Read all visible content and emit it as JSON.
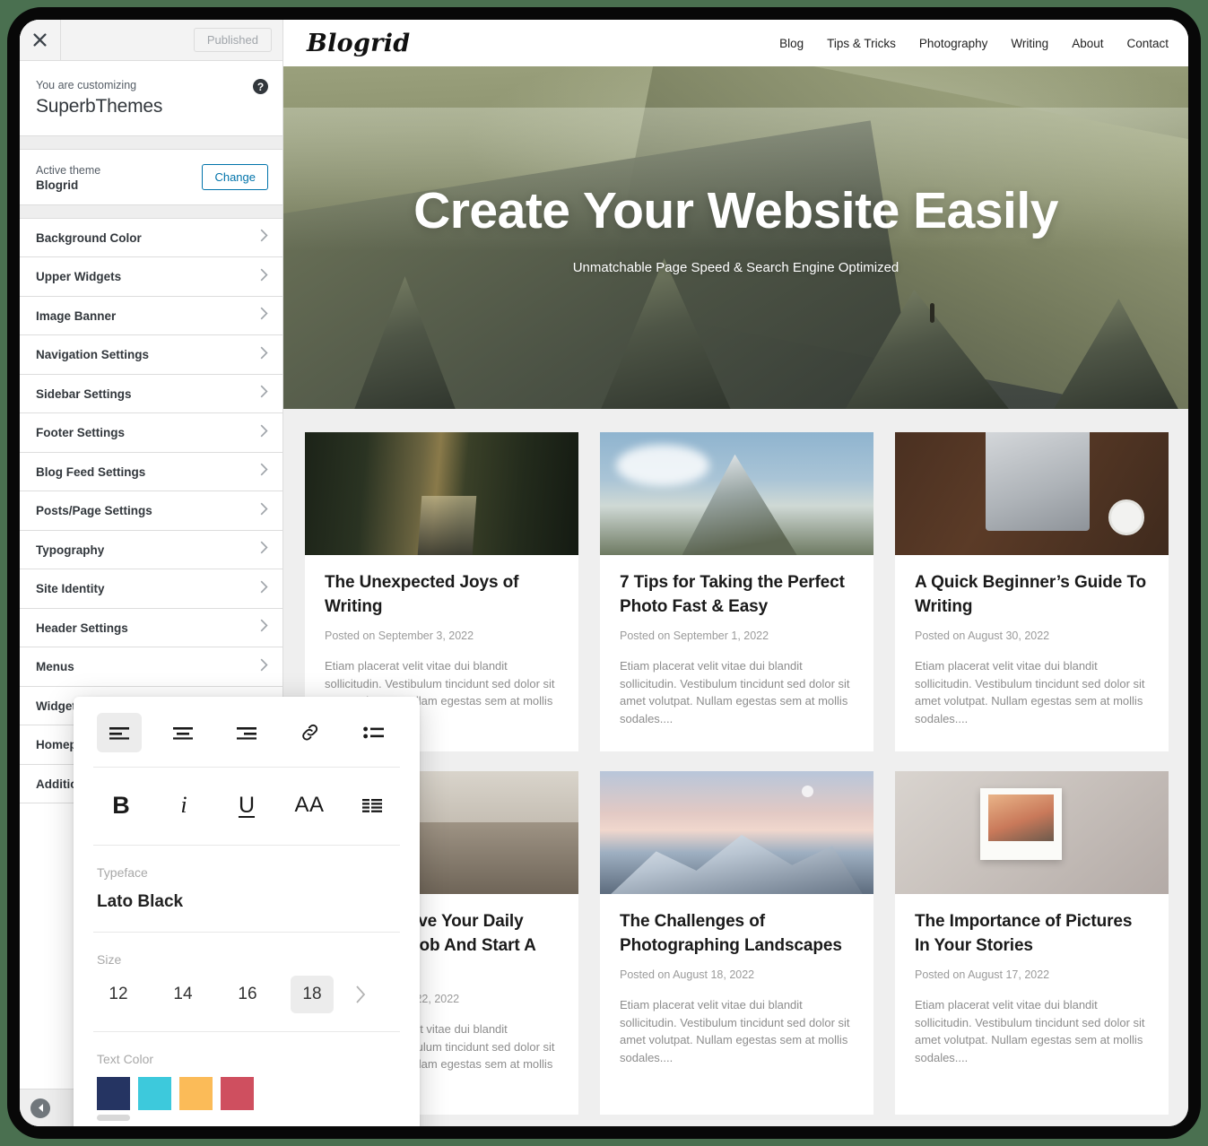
{
  "customizer": {
    "close_icon": "close-icon",
    "publish_label": "Published",
    "info_label": "You are customizing",
    "info_title": "SuperbThemes",
    "help_icon": "help-icon",
    "theme_label": "Active theme",
    "theme_name": "Blogrid",
    "change_label": "Change",
    "collapse_icon": "collapse-sidebar-icon",
    "items": [
      {
        "label": "Background Color"
      },
      {
        "label": "Upper Widgets"
      },
      {
        "label": "Image Banner"
      },
      {
        "label": "Navigation Settings"
      },
      {
        "label": "Sidebar Settings"
      },
      {
        "label": "Footer Settings"
      },
      {
        "label": "Blog Feed Settings"
      },
      {
        "label": "Posts/Page Settings"
      },
      {
        "label": "Typography"
      },
      {
        "label": "Site Identity"
      },
      {
        "label": "Header Settings"
      },
      {
        "label": "Menus"
      },
      {
        "label": "Widgets"
      },
      {
        "label": "Homepage Settings"
      },
      {
        "label": "Additional CSS"
      }
    ]
  },
  "site": {
    "logo": "Blogrid",
    "nav": [
      {
        "label": "Blog"
      },
      {
        "label": "Tips & Tricks"
      },
      {
        "label": "Photography"
      },
      {
        "label": "Writing"
      },
      {
        "label": "About"
      },
      {
        "label": "Contact"
      }
    ],
    "hero": {
      "title": "Create Your Website Easily",
      "subtitle": "Unmatchable Page Speed & Search Engine Optimized"
    },
    "posts": [
      {
        "title": "The Unexpected Joys of Writing",
        "date": "Posted on September 3, 2022",
        "excerpt": "Etiam placerat velit vitae dui blandit sollicitudin. Vestibulum tincidunt sed dolor sit amet volutpat. Nullam egestas sem at mollis sodales....",
        "image": "forest-road-photo"
      },
      {
        "title": "7 Tips for Taking the Perfect Photo Fast & Easy",
        "date": "Posted on September 1, 2022",
        "excerpt": "Etiam placerat velit vitae dui blandit sollicitudin. Vestibulum tincidunt sed dolor sit amet volutpat. Nullam egestas sem at mollis sodales....",
        "image": "matterhorn-mountain-photo"
      },
      {
        "title": "A Quick Beginner’s Guide To Writing",
        "date": "Posted on August 30, 2022",
        "excerpt": "Etiam placerat velit vitae dui blandit sollicitudin. Vestibulum tincidunt sed dolor sit amet volutpat. Nullam egestas sem at mollis sodales....",
        "image": "laptop-desk-photo"
      },
      {
        "title": "How To Leave Your Daily Corporate Job And Start A Startup",
        "date": "Posted on August 22, 2022",
        "excerpt": "Etiam placerat velit vitae dui blandit sollicitudin. Vestibulum tincidunt sed dolor sit amet volutpat. Nullam egestas sem at mollis sodales....",
        "image": "office-interior-photo"
      },
      {
        "title": "The Challenges of Photographing Landscapes",
        "date": "Posted on August 18, 2022",
        "excerpt": "Etiam placerat velit vitae dui blandit sollicitudin. Vestibulum tincidunt sed dolor sit amet volutpat. Nullam egestas sem at mollis sodales....",
        "image": "snowy-mountains-photo"
      },
      {
        "title": "The Importance of Pictures In Your Stories",
        "date": "Posted on August 17, 2022",
        "excerpt": "Etiam placerat velit vitae dui blandit sollicitudin. Vestibulum tincidunt sed dolor sit amet volutpat. Nullam egestas sem at mollis sodales....",
        "image": "polaroid-photo"
      }
    ]
  },
  "typography_panel": {
    "align_tools": [
      {
        "icon": "align-left-icon",
        "active": true
      },
      {
        "icon": "align-center-icon",
        "active": false
      },
      {
        "icon": "align-right-icon",
        "active": false
      },
      {
        "icon": "link-icon",
        "active": false
      },
      {
        "icon": "bulleted-list-icon",
        "active": false
      }
    ],
    "format_tools": [
      {
        "icon": "bold-icon",
        "glyph": "B"
      },
      {
        "icon": "italic-icon",
        "glyph": "i"
      },
      {
        "icon": "underline-icon",
        "glyph": "U"
      },
      {
        "icon": "font-size-icon",
        "glyph": "AA"
      },
      {
        "icon": "line-height-icon",
        "glyph": ""
      }
    ],
    "typeface_label": "Typeface",
    "typeface_value": "Lato Black",
    "size_label": "Size",
    "sizes": [
      "12",
      "14",
      "16",
      "18"
    ],
    "size_selected": "18",
    "size_more_icon": "chevron-right-icon",
    "text_color_label": "Text Color",
    "colors": [
      "#253462",
      "#3dc9dc",
      "#fbbb58",
      "#cf4f5f"
    ]
  },
  "theme_colors": {
    "page_background": "#4a7050",
    "accent_link": "#0073aa"
  }
}
